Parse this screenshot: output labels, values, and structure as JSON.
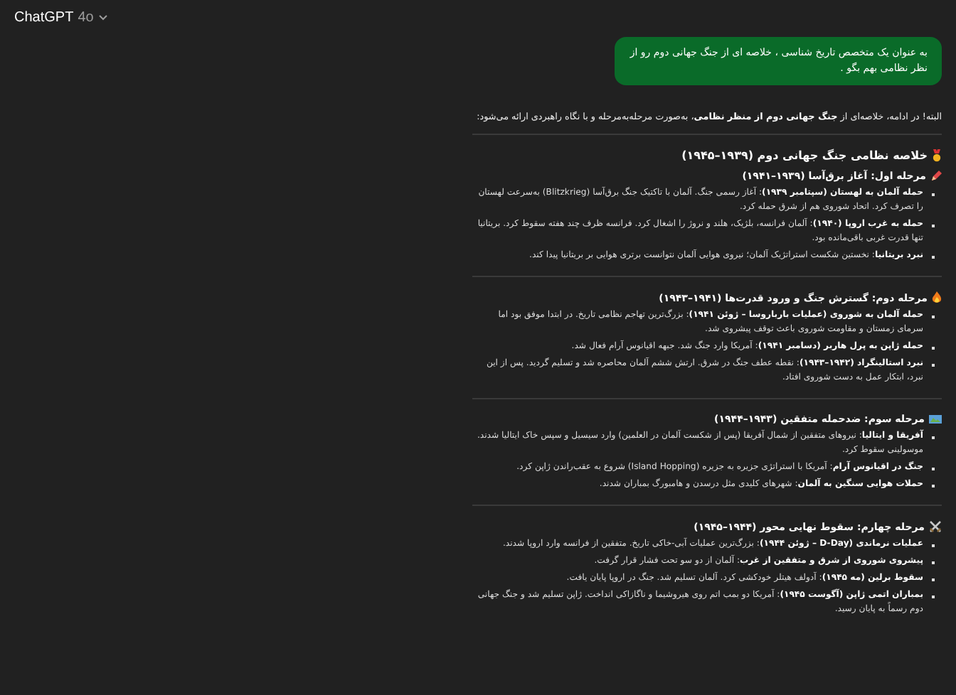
{
  "header": {
    "title": "ChatGPT",
    "model": "4o"
  },
  "user_message": "به عنوان یک متخصص تاریخ شناسی ، خلاصه ای از جنگ جهانی دوم رو از نظر نظامی بهم بگو .",
  "reply": {
    "intro": "البته! در ادامه، خلاصه‌ای از **جنگ جهانی دوم از منظر نظامی**، به‌صورت مرحله‌به‌مرحله و با نگاه راهبردی ارائه می‌شود:",
    "heading": "خلاصه نظامی جنگ جهانی دوم (۱۹۳۹–۱۹۴۵)",
    "sections": [
      {
        "title": "مرحله اول: آغاز برق‌آسا (۱۹۳۹–۱۹۴۱)",
        "bullets": [
          "**حمله آلمان به لهستان (سپتامبر ۱۹۳۹)**: آغاز رسمی جنگ. آلمان با تاکتیک جنگ برق‌آسا (Blitzkrieg) به‌سرعت لهستان را تصرف کرد. اتحاد شوروی هم از شرق حمله کرد.",
          "**حمله به غرب اروپا (۱۹۴۰)**: آلمان فرانسه، بلژیک، هلند و نروژ را اشغال کرد. فرانسه ظرف چند هفته سقوط کرد. بریتانیا تنها قدرت غربی باقی‌مانده بود.",
          "**نبرد بریتانیا**: نخستین شکست استراتژیک آلمان؛ نیروی هوایی آلمان نتوانست برتری هوایی بر بریتانیا پیدا کند."
        ]
      },
      {
        "title": "مرحله دوم: گسترش جنگ و ورود قدرت‌ها (۱۹۴۱–۱۹۴۳)",
        "bullets": [
          "**حمله آلمان به شوروی (عملیات بارباروسا – ژوئن ۱۹۴۱)**: بزرگ‌ترین تهاجم نظامی تاریخ. در ابتدا موفق بود اما سرمای زمستان و مقاومت شوروی باعث توقف پیشروی شد.",
          "**حمله ژاپن به پرل هاربر (دسامبر ۱۹۴۱)**: آمریکا وارد جنگ شد. جبهه اقیانوس آرام فعال شد.",
          "**نبرد استالینگراد (۱۹۴۲–۱۹۴۳)**: نقطه عطف جنگ در شرق. ارتش ششم آلمان محاصره شد و تسلیم گردید. پس از این نبرد، ابتکار عمل به دست شوروی افتاد."
        ]
      },
      {
        "title": "مرحله سوم: ضدحمله متفقین (۱۹۴۳–۱۹۴۴)",
        "bullets": [
          "**آفریقا و ایتالیا**: نیروهای متفقین از شمال آفریقا (پس از شکست آلمان در العلمین) وارد سیسیل و سپس خاک ایتالیا شدند. موسولینی سقوط کرد.",
          "**جنگ در اقیانوس آرام**: آمریکا با استراتژی جزیره به جزیره (Island Hopping) شروع به عقب‌راندن ژاپن کرد.",
          "**حملات هوایی سنگین به آلمان**: شهرهای کلیدی مثل درسدن و هامبورگ بمباران شدند."
        ]
      },
      {
        "title": "مرحله چهارم: سقوط نهایی محور (۱۹۴۴–۱۹۴۵)",
        "bullets": [
          "**عملیات نرماندی (D-Day – ژوئن ۱۹۴۴)**: بزرگ‌ترین عملیات آبی-خاکی تاریخ. متفقین از فرانسه وارد اروپا شدند.",
          "**پیشروی شوروی از شرق و متفقین از غرب**: آلمان از دو سو تحت فشار قرار گرفت.",
          "**سقوط برلین (مه ۱۹۴۵)**: آدولف هیتلر خودکشی کرد. آلمان تسلیم شد. جنگ در اروپا پایان یافت.",
          "**بمباران اتمی ژاپن (آگوست ۱۹۴۵)**: آمریکا دو بمب اتم روی هیروشیما و ناگازاکی انداخت. ژاپن تسلیم شد و جنگ جهانی دوم رسماً به پایان رسید."
        ]
      }
    ]
  }
}
